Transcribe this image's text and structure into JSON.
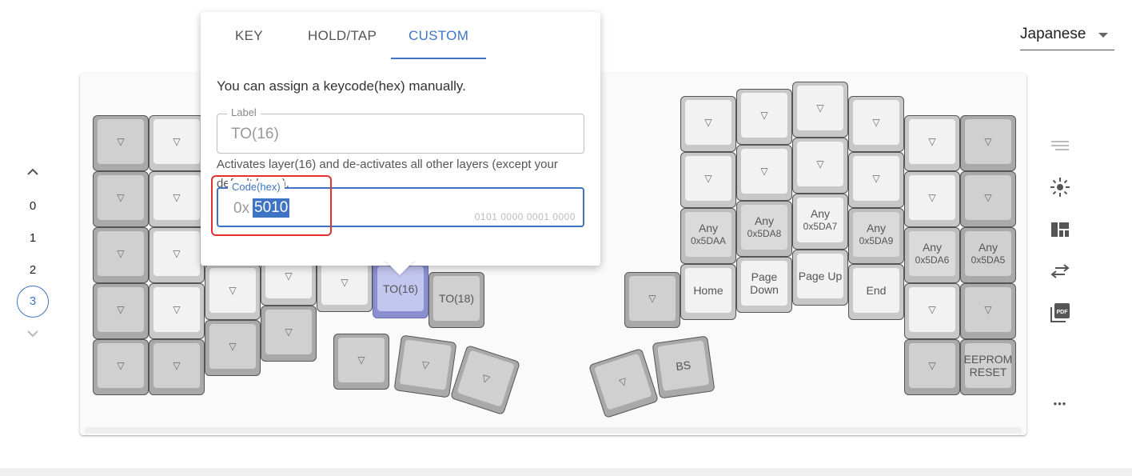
{
  "language": {
    "selected": "Japanese"
  },
  "layers": {
    "items": [
      "0",
      "1",
      "2",
      "3"
    ],
    "active": "3"
  },
  "popover": {
    "tabs": [
      "KEY",
      "HOLD/TAP",
      "CUSTOM"
    ],
    "active_tab": "CUSTOM",
    "description": "You can assign a keycode(hex) manually.",
    "label_field": {
      "legend": "Label",
      "value": "TO(16)"
    },
    "help_text": "Activates layer(16) and de-activates all other layers (except your default layer).",
    "code_field": {
      "legend": "Code(hex)",
      "prefix": "0x",
      "value": "5010",
      "bits": "0101 0000 0001 0000"
    }
  },
  "keys": {
    "arrow": "▽",
    "to16": "TO(16)",
    "to18": "TO(18)",
    "any": "Any",
    "c5daa": "0x5DAA",
    "c5da8": "0x5DA8",
    "c5da7": "0x5DA7",
    "c5da9": "0x5DA9",
    "c5da6": "0x5DA6",
    "c5da5": "0x5DA5",
    "home": "Home",
    "pagedown_1": "Page",
    "pagedown_2": "Down",
    "pageup": "Page Up",
    "end": "End",
    "bs": "BS",
    "eeprom_1": "EEPROM",
    "eeprom_2": "RESET"
  },
  "toolbar": {
    "icons": [
      "list-icon",
      "brightness-icon",
      "layout-icon",
      "swap-icon",
      "pdf-icon",
      "more-icon"
    ],
    "pdf_label": "PDF",
    "more_label": "•••"
  },
  "colors": {
    "accent": "#3f74c4",
    "selected_key": "#8a8fd0",
    "highlight": "#e5302e"
  }
}
